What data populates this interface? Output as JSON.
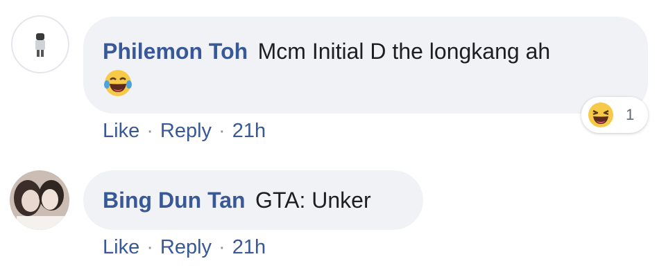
{
  "comments": [
    {
      "author": "Philemon Toh",
      "text": "Mcm Initial D the longkang ah",
      "emoji_icon": "laughing-tears-emoji",
      "reaction": {
        "icon": "haha-reaction-icon",
        "count": "1"
      },
      "actions": {
        "like": "Like",
        "reply": "Reply",
        "separator": "·",
        "time": "21h"
      }
    },
    {
      "author": "Bing Dun Tan",
      "text": "GTA: Unker",
      "actions": {
        "like": "Like",
        "reply": "Reply",
        "separator": "·",
        "time": "21h"
      }
    }
  ],
  "colors": {
    "author": "#385898",
    "bubble": "#f0f2f5",
    "meta": "#606770",
    "emoji": "#f7c948"
  }
}
